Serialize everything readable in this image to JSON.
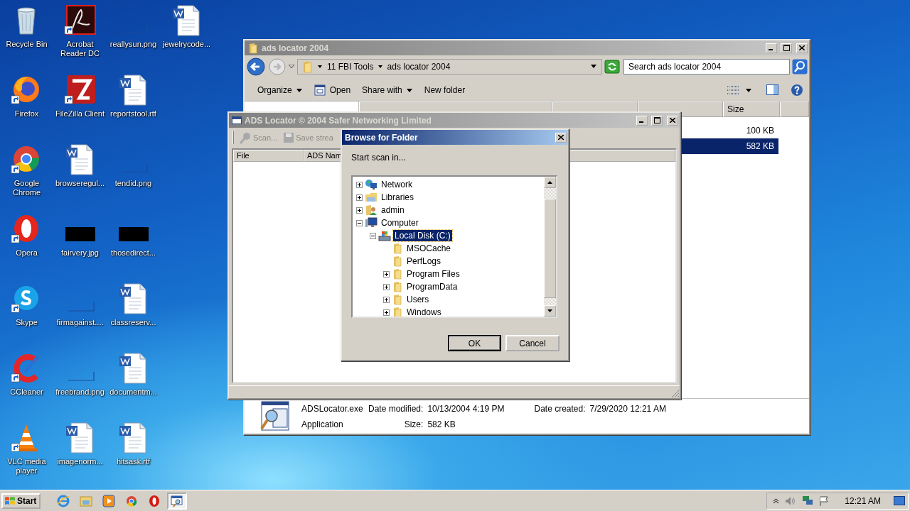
{
  "desktop": {
    "icons": [
      {
        "label": "Recycle Bin",
        "kind": "recycle",
        "shortcut": false
      },
      {
        "label": "Firefox",
        "kind": "firefox",
        "shortcut": true
      },
      {
        "label": "Google\nChrome",
        "kind": "chrome",
        "shortcut": true
      },
      {
        "label": "Opera",
        "kind": "opera",
        "shortcut": true
      },
      {
        "label": "Skype",
        "kind": "skype",
        "shortcut": true
      },
      {
        "label": "CCleaner",
        "kind": "ccleaner",
        "shortcut": true
      },
      {
        "label": "VLC media\nplayer",
        "kind": "vlc",
        "shortcut": true
      },
      {
        "label": "Acrobat\nReader DC",
        "kind": "acrobat",
        "shortcut": true
      },
      {
        "label": "FileZilla Client",
        "kind": "filezilla",
        "shortcut": true
      },
      {
        "label": "browseregul...",
        "kind": "doc",
        "shortcut": false
      },
      {
        "label": "fairvery.jpg",
        "kind": "black",
        "shortcut": false
      },
      {
        "label": "firmagainst....",
        "kind": "blank",
        "shortcut": false
      },
      {
        "label": "freebrand.png",
        "kind": "blank",
        "shortcut": false
      },
      {
        "label": "imagenorm...",
        "kind": "doc",
        "shortcut": false
      },
      {
        "label": "reallysun.png",
        "kind": "blank",
        "shortcut": false
      },
      {
        "label": "reportstool.rtf",
        "kind": "doc",
        "shortcut": false
      },
      {
        "label": "tendid.png",
        "kind": "blank",
        "shortcut": false
      },
      {
        "label": "thosedirect...",
        "kind": "black",
        "shortcut": false
      },
      {
        "label": "classreserv...",
        "kind": "doc",
        "shortcut": false
      },
      {
        "label": "documentm...",
        "kind": "doc",
        "shortcut": false
      },
      {
        "label": "hitsask.rtf",
        "kind": "doc",
        "shortcut": false
      },
      {
        "label": "jewelrycode...",
        "kind": "doc",
        "shortcut": false
      }
    ]
  },
  "explorer": {
    "title": "ads locator 2004",
    "breadcrumb": [
      "11 FBI Tools",
      "ads locator 2004"
    ],
    "search": {
      "placeholder": "Search ads locator 2004"
    },
    "toolbar": [
      {
        "label": "Organize",
        "kind": "menu"
      },
      {
        "label": "Open",
        "kind": "open"
      },
      {
        "label": "Share with",
        "kind": "menu"
      },
      {
        "label": "New folder",
        "kind": "plain"
      }
    ],
    "columns": [
      "Size"
    ],
    "rows": [
      {
        "size": "100 KB",
        "selected": false
      },
      {
        "size": "582 KB",
        "selected": true
      }
    ],
    "details": {
      "name": "ADSLocator.exe",
      "type": "Application",
      "fields": [
        {
          "label": "Date modified:",
          "value": "10/13/2004 4:19 PM"
        },
        {
          "label": "Date created:",
          "value": "7/29/2020 12:21 AM"
        },
        {
          "label": "Size:",
          "value": "582 KB"
        }
      ]
    }
  },
  "ads": {
    "title": "ADS Locator © 2004 Safer Networking Limited",
    "toolbar": [
      {
        "label": "Scan...",
        "kind": "scan",
        "disabled": true
      },
      {
        "label": "Save strea",
        "kind": "save",
        "disabled": true
      }
    ],
    "columns": [
      "File",
      "ADS Nam"
    ]
  },
  "dialog": {
    "title": "Browse for Folder",
    "prompt": "Start scan in...",
    "tree": [
      {
        "label": "Network",
        "kind": "network",
        "expanded": false,
        "selected": false
      },
      {
        "label": "Libraries",
        "kind": "libraries",
        "expanded": false,
        "selected": false
      },
      {
        "label": "admin",
        "kind": "user",
        "expanded": false,
        "selected": false
      },
      {
        "label": "Computer",
        "kind": "computer",
        "expanded": true,
        "selected": false,
        "children": [
          {
            "label": "Local Disk (C:)",
            "kind": "drive",
            "expanded": true,
            "selected": true,
            "children": [
              {
                "label": "MSOCache",
                "kind": "folder",
                "selected": false
              },
              {
                "label": "PerfLogs",
                "kind": "folder",
                "selected": false
              },
              {
                "label": "Program Files",
                "kind": "folder",
                "expanded": false,
                "selected": false
              },
              {
                "label": "ProgramData",
                "kind": "folder",
                "expanded": false,
                "selected": false
              },
              {
                "label": "Users",
                "kind": "folder",
                "expanded": false,
                "selected": false
              },
              {
                "label": "Windows",
                "kind": "folder",
                "expanded": false,
                "selected": false
              }
            ]
          }
        ]
      }
    ],
    "buttons": [
      {
        "label": "OK",
        "default": true
      },
      {
        "label": "Cancel",
        "default": false
      }
    ]
  },
  "taskbar": {
    "start": "Start",
    "items": [
      {
        "kind": "ie",
        "selected": false
      },
      {
        "kind": "explorer",
        "selected": false
      },
      {
        "kind": "media",
        "selected": false
      },
      {
        "kind": "chrome",
        "selected": false
      },
      {
        "kind": "opera",
        "selected": false
      },
      {
        "kind": "ads",
        "selected": true
      }
    ],
    "time": "12:21 AM"
  }
}
